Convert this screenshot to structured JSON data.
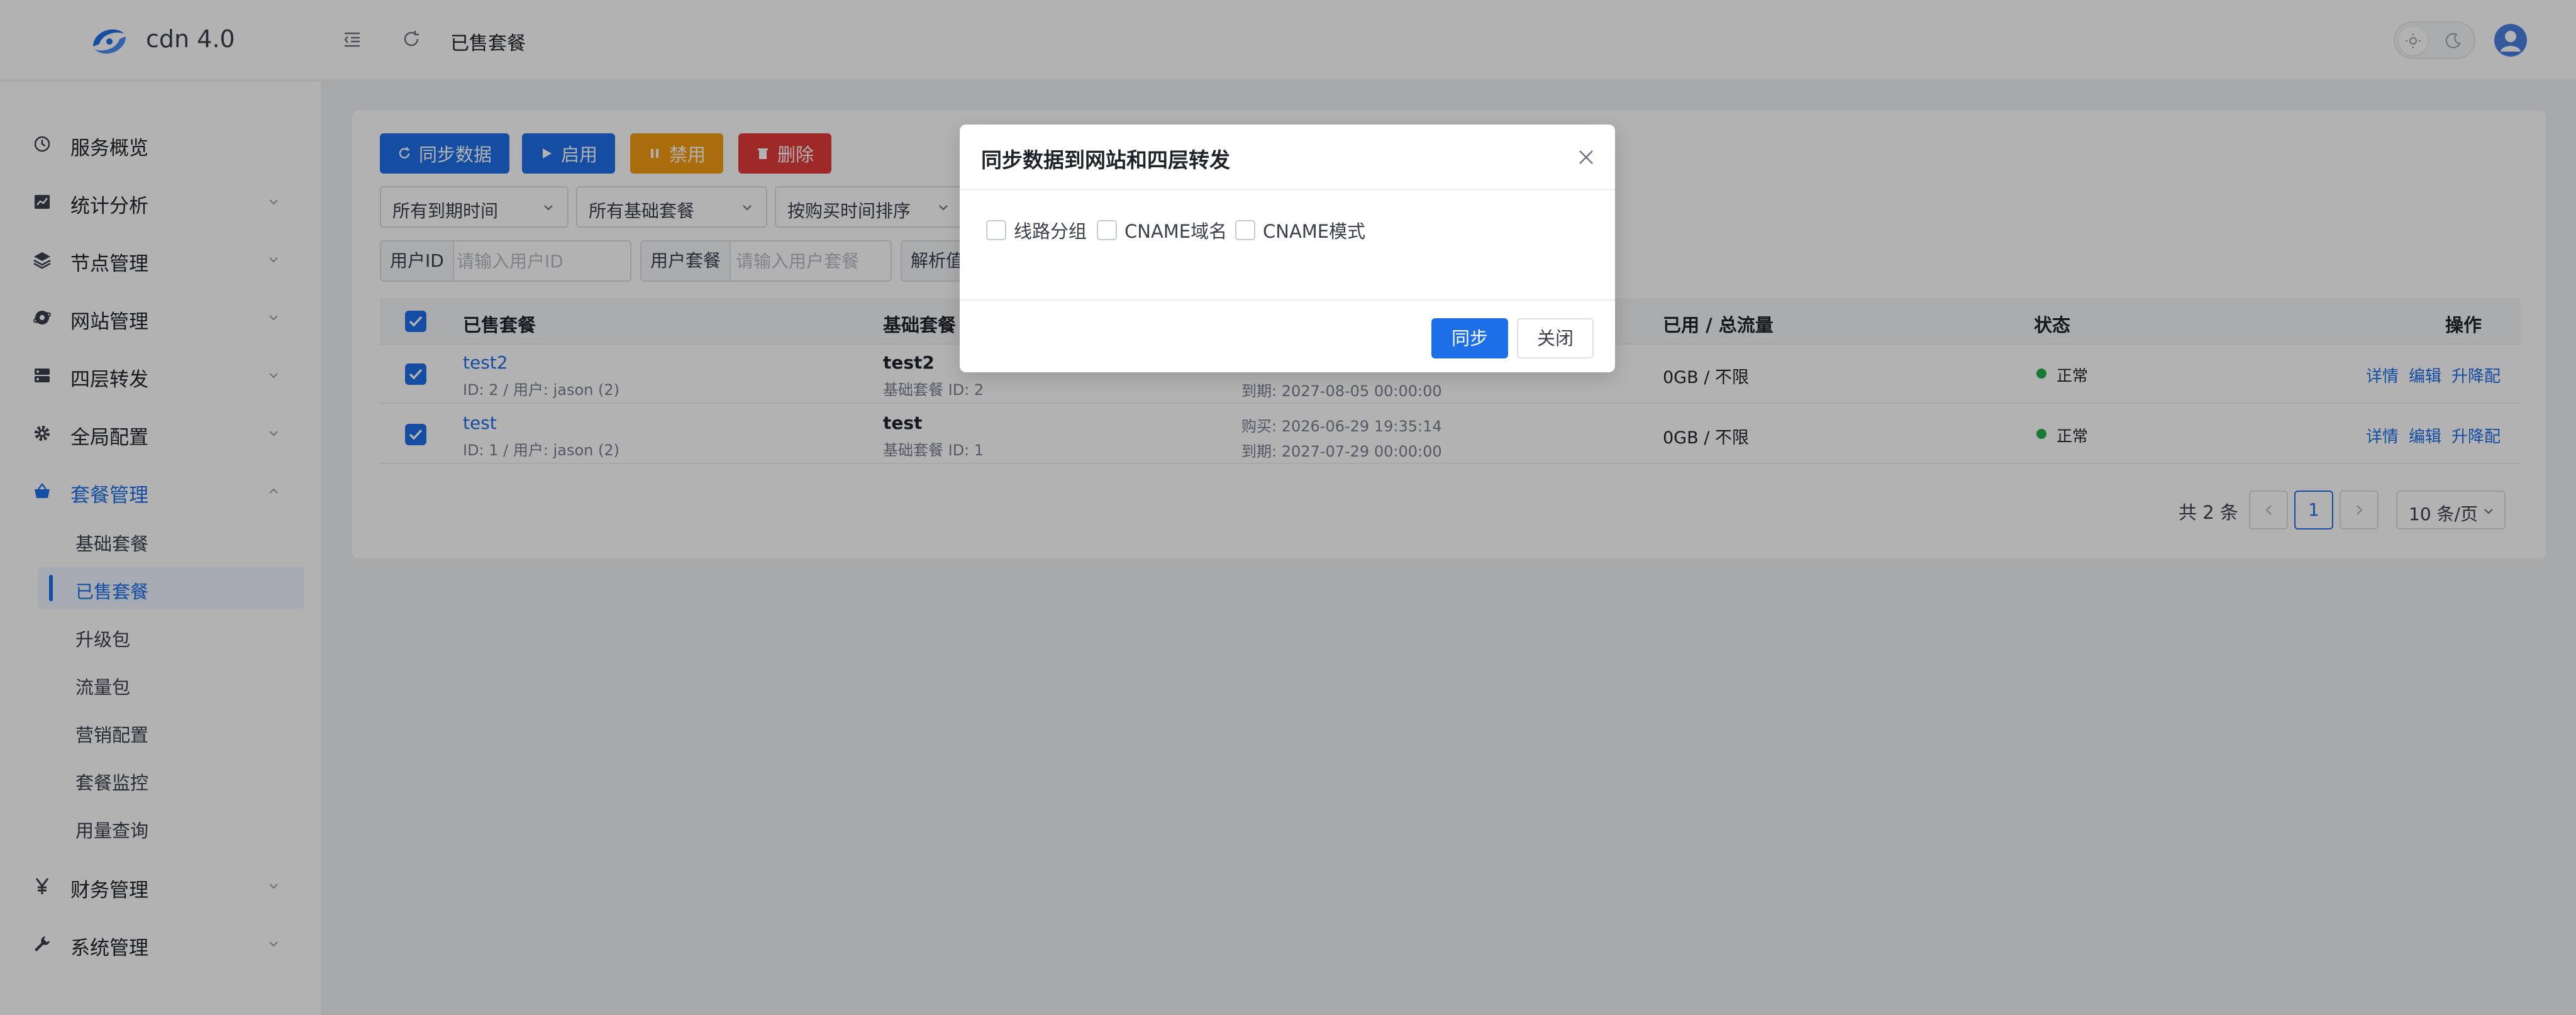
{
  "app": {
    "title": "cdn 4.0"
  },
  "header": {
    "breadcrumb": "已售套餐"
  },
  "sidebar": {
    "items": [
      {
        "label": "服务概览",
        "icon": "clock-icon"
      },
      {
        "label": "统计分析",
        "icon": "chart-icon"
      },
      {
        "label": "节点管理",
        "icon": "layers-icon"
      },
      {
        "label": "网站管理",
        "icon": "globe-icon"
      },
      {
        "label": "四层转发",
        "icon": "forward-icon"
      },
      {
        "label": "全局配置",
        "icon": "gear-icon"
      },
      {
        "label": "套餐管理",
        "icon": "basket-icon"
      }
    ],
    "subitems": [
      "基础套餐",
      "已售套餐",
      "升级包",
      "流量包",
      "营销配置",
      "套餐监控",
      "用量查询"
    ],
    "bottom_items": [
      {
        "label": "财务管理",
        "icon": "yen-icon"
      },
      {
        "label": "系统管理",
        "icon": "wrench-icon"
      }
    ]
  },
  "toolbar": {
    "sync_label": "同步数据",
    "enable_label": "启用",
    "disable_label": "禁用",
    "delete_label": "删除"
  },
  "filters": {
    "expire": "所有到期时间",
    "base_package": "所有基础套餐",
    "sort": "按购买时间排序"
  },
  "search": {
    "user_id_label": "用户ID",
    "user_id_placeholder": "请输入用户ID",
    "user_package_label": "用户套餐",
    "user_package_placeholder": "请输入用户套餐",
    "resolve_label": "解析值"
  },
  "table": {
    "headers": {
      "sold": "已售套餐",
      "base": "基础套餐",
      "usage": "已用 / 总流量",
      "status": "状态",
      "actions": "操作"
    },
    "rows": [
      {
        "name": "test2",
        "meta": "ID: 2 / 用户: jason (2)",
        "base": "test2",
        "base_id": "基础套餐 ID: 2",
        "date_line": "到期: 2027-08-05 00:00:00",
        "usage": "0GB / 不限",
        "status": "正常",
        "act_detail": "详情",
        "act_edit": "编辑",
        "act_upgrade": "升降配"
      },
      {
        "name": "test",
        "meta": "ID: 1 / 用户: jason (2)",
        "base": "test",
        "base_id": "基础套餐 ID: 1",
        "buy_line": "购买: 2026-06-29 19:35:14",
        "date_line": "到期: 2027-07-29 00:00:00",
        "usage": "0GB / 不限",
        "status": "正常",
        "act_detail": "详情",
        "act_edit": "编辑",
        "act_upgrade": "升降配"
      }
    ]
  },
  "pagination": {
    "total": "共 2 条",
    "current": "1",
    "page_size": "10 条/页"
  },
  "modal": {
    "title": "同步数据到网站和四层转发",
    "options": [
      "线路分组",
      "CNAME域名",
      "CNAME模式"
    ],
    "confirm": "同步",
    "close": "关闭"
  },
  "colors": {
    "primary": "#1d6fe8",
    "orange": "#f39c12",
    "red": "#e23c3c",
    "success": "#22b14c"
  }
}
